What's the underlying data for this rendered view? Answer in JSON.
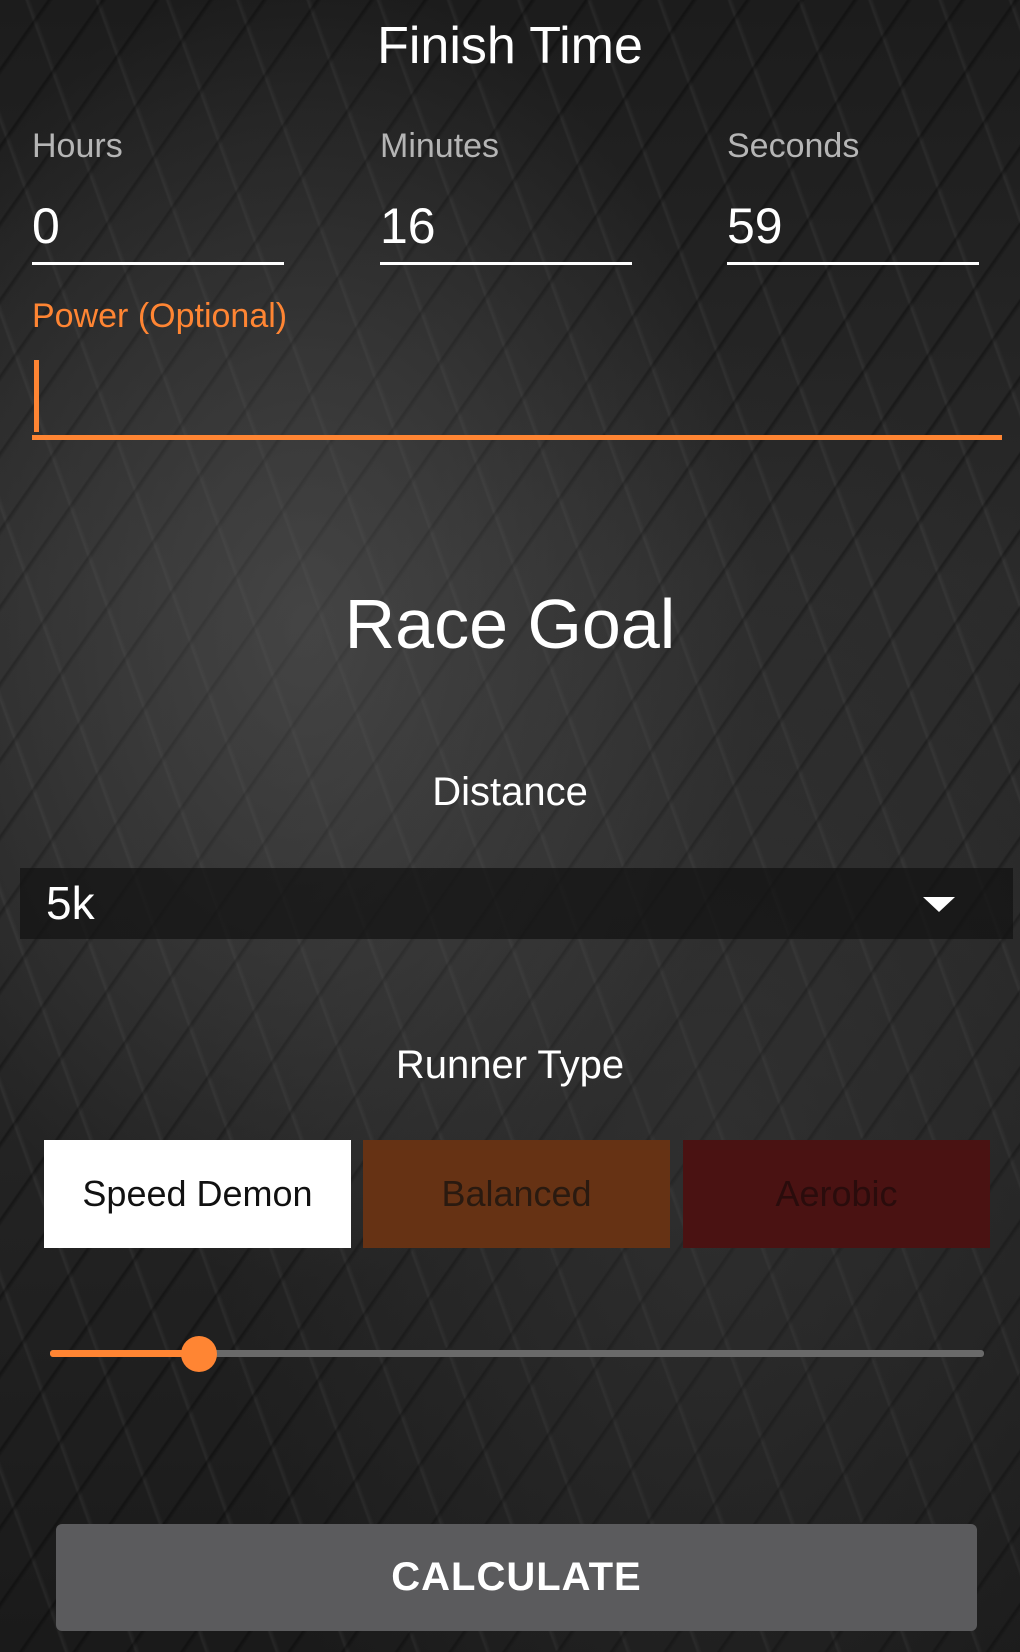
{
  "finish_time": {
    "title": "Finish Time",
    "hours": {
      "label": "Hours",
      "value": "0"
    },
    "minutes": {
      "label": "Minutes",
      "value": "16"
    },
    "seconds": {
      "label": "Seconds",
      "value": "59"
    },
    "power": {
      "label": "Power (Optional)",
      "value": ""
    }
  },
  "race_goal": {
    "title": "Race Goal",
    "distance_label": "Distance",
    "distance_value": "5k",
    "runner_type_label": "Runner Type",
    "runner_types": [
      {
        "label": "Speed Demon",
        "selected": true
      },
      {
        "label": "Balanced",
        "selected": false
      },
      {
        "label": "Aerobic",
        "selected": false
      }
    ],
    "slider_fraction": 0.16
  },
  "calculate_label": "CALCULATE",
  "colors": {
    "accent": "#ff8533",
    "balanced": "#663214",
    "aerobic": "#4a1212",
    "button": "#5b5b5d"
  },
  "icons": {
    "dropdown": "chevron-down-icon"
  }
}
